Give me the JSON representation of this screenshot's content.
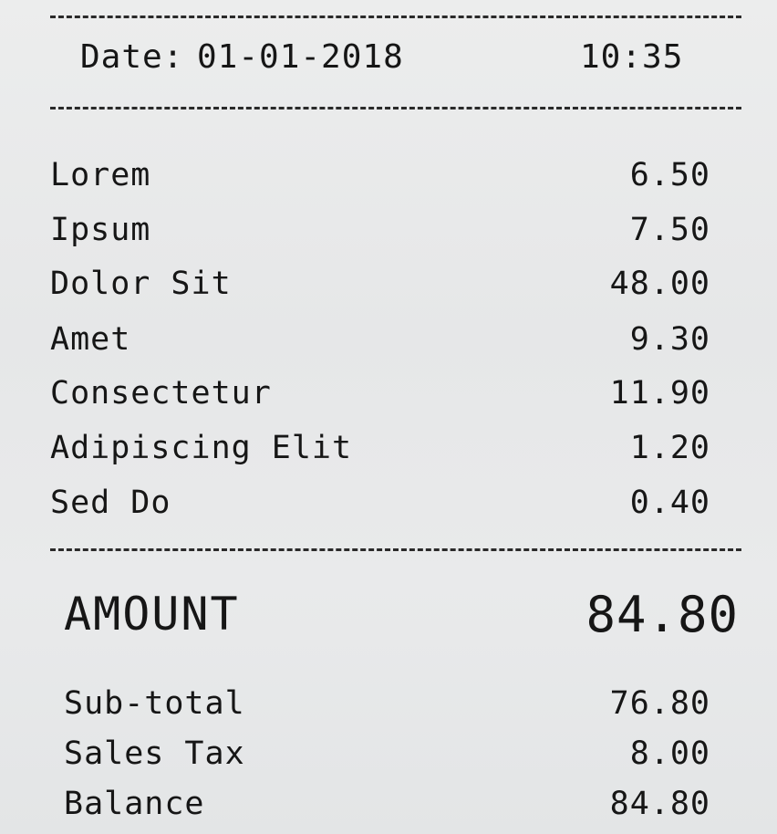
{
  "header": {
    "date_label": "Date:",
    "date_value": "01-01-2018",
    "time_value": "10:35"
  },
  "items": [
    {
      "name": "Lorem",
      "price": "6.50"
    },
    {
      "name": "Ipsum",
      "price": "7.50"
    },
    {
      "name": "Dolor Sit",
      "price": "48.00"
    },
    {
      "name": "Amet",
      "price": "9.30"
    },
    {
      "name": "Consectetur",
      "price": "11.90"
    },
    {
      "name": "Adipiscing Elit",
      "price": "1.20"
    },
    {
      "name": "Sed Do",
      "price": "0.40"
    }
  ],
  "amount": {
    "label": "AMOUNT",
    "value": "84.80"
  },
  "summary": [
    {
      "label": "Sub-total",
      "value": "76.80"
    },
    {
      "label": "Sales Tax",
      "value": "8.00"
    },
    {
      "label": "Balance",
      "value": "84.80"
    }
  ]
}
